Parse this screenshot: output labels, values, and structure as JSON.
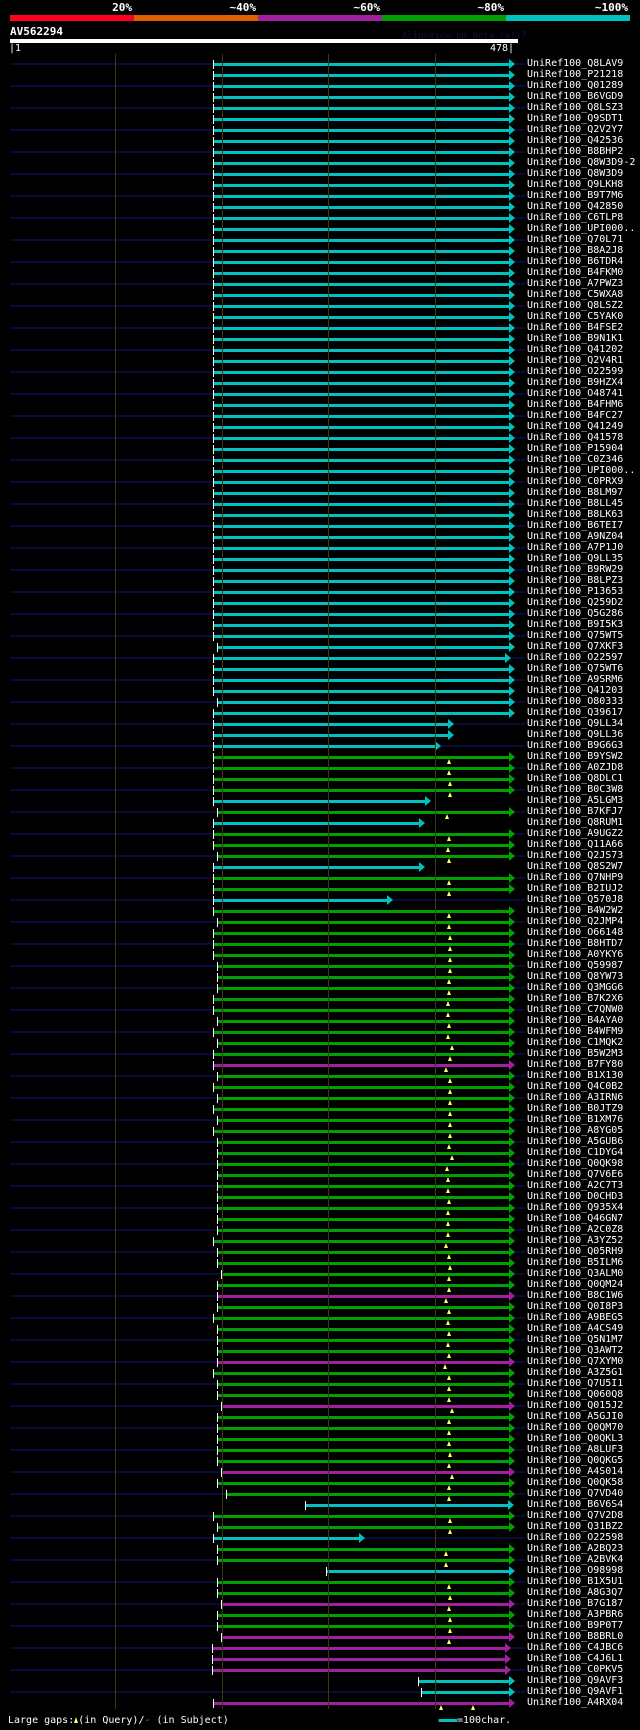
{
  "legend": {
    "labels": [
      "20%",
      "~40%",
      "~60%",
      "~80%",
      "~100%"
    ],
    "colors": [
      "#ff0020",
      "#e06000",
      "#a020a0",
      "#00a000",
      "#00c0c0"
    ]
  },
  "query": {
    "name": "AV562294",
    "credit": "AlignView.pm Beta rel.7",
    "start_label": "|1",
    "end_label": "478|",
    "length": 478
  },
  "grid_every": 100,
  "color_map": {
    "cyan": "#00c0c0",
    "green": "#00a000",
    "magenta": "#a020a0"
  },
  "hits": [
    {
      "label": "UniRef100_Q8LAV9",
      "c": "cyan",
      "s": 192,
      "e": 470
    },
    {
      "label": "UniRef100_P21218",
      "c": "cyan",
      "s": 192,
      "e": 470
    },
    {
      "label": "UniRef100_Q01289",
      "c": "cyan",
      "s": 192,
      "e": 470
    },
    {
      "label": "UniRef100_B6VGD9",
      "c": "cyan",
      "s": 192,
      "e": 470
    },
    {
      "label": "UniRef100_Q8LSZ3",
      "c": "cyan",
      "s": 192,
      "e": 470
    },
    {
      "label": "UniRef100_Q9SDT1",
      "c": "cyan",
      "s": 192,
      "e": 470
    },
    {
      "label": "UniRef100_Q2V2Y7",
      "c": "cyan",
      "s": 192,
      "e": 470
    },
    {
      "label": "UniRef100_Q42536",
      "c": "cyan",
      "s": 192,
      "e": 470
    },
    {
      "label": "UniRef100_B8BHP2",
      "c": "cyan",
      "s": 192,
      "e": 470
    },
    {
      "label": "UniRef100_Q8W3D9-2",
      "c": "cyan",
      "s": 192,
      "e": 470
    },
    {
      "label": "UniRef100_Q8W3D9",
      "c": "cyan",
      "s": 192,
      "e": 470
    },
    {
      "label": "UniRef100_Q9LKH8",
      "c": "cyan",
      "s": 192,
      "e": 470
    },
    {
      "label": "UniRef100_B9T7M6",
      "c": "cyan",
      "s": 192,
      "e": 470
    },
    {
      "label": "UniRef100_Q42850",
      "c": "cyan",
      "s": 192,
      "e": 470
    },
    {
      "label": "UniRef100_C6TLP8",
      "c": "cyan",
      "s": 192,
      "e": 470
    },
    {
      "label": "UniRef100_UPI000..",
      "c": "cyan",
      "s": 192,
      "e": 470
    },
    {
      "label": "UniRef100_Q70L71",
      "c": "cyan",
      "s": 192,
      "e": 470
    },
    {
      "label": "UniRef100_B8A2J8",
      "c": "cyan",
      "s": 192,
      "e": 470
    },
    {
      "label": "UniRef100_B6TDR4",
      "c": "cyan",
      "s": 192,
      "e": 470
    },
    {
      "label": "UniRef100_B4FKM0",
      "c": "cyan",
      "s": 192,
      "e": 470
    },
    {
      "label": "UniRef100_A7PWZ3",
      "c": "cyan",
      "s": 192,
      "e": 470
    },
    {
      "label": "UniRef100_C5WXA8",
      "c": "cyan",
      "s": 192,
      "e": 470
    },
    {
      "label": "UniRef100_Q8LSZ2",
      "c": "cyan",
      "s": 192,
      "e": 470
    },
    {
      "label": "UniRef100_C5YAK0",
      "c": "cyan",
      "s": 192,
      "e": 470
    },
    {
      "label": "UniRef100_B4FSE2",
      "c": "cyan",
      "s": 192,
      "e": 470
    },
    {
      "label": "UniRef100_B9N1K1",
      "c": "cyan",
      "s": 192,
      "e": 470
    },
    {
      "label": "UniRef100_Q41202",
      "c": "cyan",
      "s": 192,
      "e": 470
    },
    {
      "label": "UniRef100_Q2V4R1",
      "c": "cyan",
      "s": 192,
      "e": 470
    },
    {
      "label": "UniRef100_O22599",
      "c": "cyan",
      "s": 192,
      "e": 470
    },
    {
      "label": "UniRef100_B9HZX4",
      "c": "cyan",
      "s": 192,
      "e": 470
    },
    {
      "label": "UniRef100_O48741",
      "c": "cyan",
      "s": 192,
      "e": 470
    },
    {
      "label": "UniRef100_B4FHM6",
      "c": "cyan",
      "s": 192,
      "e": 470
    },
    {
      "label": "UniRef100_B4FC27",
      "c": "cyan",
      "s": 192,
      "e": 470
    },
    {
      "label": "UniRef100_Q41249",
      "c": "cyan",
      "s": 192,
      "e": 470
    },
    {
      "label": "UniRef100_Q41578",
      "c": "cyan",
      "s": 192,
      "e": 470
    },
    {
      "label": "UniRef100_P15904",
      "c": "cyan",
      "s": 192,
      "e": 470
    },
    {
      "label": "UniRef100_C0Z346",
      "c": "cyan",
      "s": 192,
      "e": 470
    },
    {
      "label": "UniRef100_UPI000..",
      "c": "cyan",
      "s": 192,
      "e": 470
    },
    {
      "label": "UniRef100_C0PRX9",
      "c": "cyan",
      "s": 192,
      "e": 470
    },
    {
      "label": "UniRef100_B8LM97",
      "c": "cyan",
      "s": 192,
      "e": 470
    },
    {
      "label": "UniRef100_B8LL45",
      "c": "cyan",
      "s": 192,
      "e": 470
    },
    {
      "label": "UniRef100_B8LK63",
      "c": "cyan",
      "s": 192,
      "e": 470
    },
    {
      "label": "UniRef100_B6TEI7",
      "c": "cyan",
      "s": 192,
      "e": 470
    },
    {
      "label": "UniRef100_A9NZ04",
      "c": "cyan",
      "s": 192,
      "e": 470
    },
    {
      "label": "UniRef100_A7P1J0",
      "c": "cyan",
      "s": 192,
      "e": 470
    },
    {
      "label": "UniRef100_Q9LL35",
      "c": "cyan",
      "s": 192,
      "e": 470
    },
    {
      "label": "UniRef100_B9RW29",
      "c": "cyan",
      "s": 192,
      "e": 470
    },
    {
      "label": "UniRef100_B8LPZ3",
      "c": "cyan",
      "s": 192,
      "e": 470
    },
    {
      "label": "UniRef100_P13653",
      "c": "cyan",
      "s": 192,
      "e": 470
    },
    {
      "label": "UniRef100_Q259D2",
      "c": "cyan",
      "s": 192,
      "e": 470
    },
    {
      "label": "UniRef100_Q5G286",
      "c": "cyan",
      "s": 192,
      "e": 470
    },
    {
      "label": "UniRef100_B9I5K3",
      "c": "cyan",
      "s": 192,
      "e": 470
    },
    {
      "label": "UniRef100_Q75WT5",
      "c": "cyan",
      "s": 192,
      "e": 470
    },
    {
      "label": "UniRef100_Q7XKF3",
      "c": "cyan",
      "s": 195,
      "e": 470
    },
    {
      "label": "UniRef100_O22597",
      "c": "cyan",
      "s": 192,
      "e": 466
    },
    {
      "label": "UniRef100_Q75WT6",
      "c": "cyan",
      "s": 192,
      "e": 470
    },
    {
      "label": "UniRef100_A9SRM6",
      "c": "cyan",
      "s": 192,
      "e": 470
    },
    {
      "label": "UniRef100_Q41203",
      "c": "cyan",
      "s": 192,
      "e": 470
    },
    {
      "label": "UniRef100_O80333",
      "c": "cyan",
      "s": 195,
      "e": 470
    },
    {
      "label": "UniRef100_Q39617",
      "c": "cyan",
      "s": 192,
      "e": 470
    },
    {
      "label": "UniRef100_Q9LL34",
      "c": "cyan",
      "s": 192,
      "e": 412
    },
    {
      "label": "UniRef100_Q9LL36",
      "c": "cyan",
      "s": 192,
      "e": 412
    },
    {
      "label": "UniRef100_B9G6G3",
      "c": "cyan",
      "s": 192,
      "e": 400
    },
    {
      "label": "UniRef100_B9YSW2",
      "c": "green",
      "s": 192,
      "e": 470,
      "g": [
        413
      ]
    },
    {
      "label": "UniRef100_A0ZJD8",
      "c": "green",
      "s": 192,
      "e": 470,
      "g": [
        413
      ]
    },
    {
      "label": "UniRef100_Q8DLC1",
      "c": "green",
      "s": 192,
      "e": 470,
      "g": [
        414
      ]
    },
    {
      "label": "UniRef100_B0C3W8",
      "c": "green",
      "s": 192,
      "e": 470,
      "g": [
        414
      ]
    },
    {
      "label": "UniRef100_A5LGM3",
      "c": "cyan",
      "s": 192,
      "e": 391
    },
    {
      "label": "UniRef100_B7KFJ7",
      "c": "green",
      "s": 195,
      "e": 470,
      "g": [
        411
      ]
    },
    {
      "label": "UniRef100_Q8RUM1",
      "c": "cyan",
      "s": 192,
      "e": 385
    },
    {
      "label": "UniRef100_A9UGZ2",
      "c": "green",
      "s": 192,
      "e": 470,
      "g": [
        413
      ]
    },
    {
      "label": "UniRef100_Q11A66",
      "c": "green",
      "s": 192,
      "e": 470,
      "g": [
        412
      ]
    },
    {
      "label": "UniRef100_Q2JS73",
      "c": "green",
      "s": 195,
      "e": 470,
      "g": [
        413
      ]
    },
    {
      "label": "UniRef100_Q8S2W7",
      "c": "cyan",
      "s": 192,
      "e": 385
    },
    {
      "label": "UniRef100_Q7NHP9",
      "c": "green",
      "s": 192,
      "e": 470,
      "g": [
        413
      ]
    },
    {
      "label": "UniRef100_B2IUJ2",
      "c": "green",
      "s": 192,
      "e": 470,
      "g": [
        413
      ]
    },
    {
      "label": "UniRef100_Q570J8",
      "c": "cyan",
      "s": 192,
      "e": 355
    },
    {
      "label": "UniRef100_B4W2W2",
      "c": "green",
      "s": 192,
      "e": 470,
      "g": [
        413
      ]
    },
    {
      "label": "UniRef100_Q2JMP4",
      "c": "green",
      "s": 195,
      "e": 470,
      "g": [
        413
      ]
    },
    {
      "label": "UniRef100_O66148",
      "c": "green",
      "s": 192,
      "e": 470,
      "g": [
        414
      ]
    },
    {
      "label": "UniRef100_B8HTD7",
      "c": "green",
      "s": 192,
      "e": 470,
      "g": [
        414
      ]
    },
    {
      "label": "UniRef100_A0YKY6",
      "c": "green",
      "s": 192,
      "e": 470,
      "g": [
        414
      ]
    },
    {
      "label": "UniRef100_Q59987",
      "c": "green",
      "s": 195,
      "e": 470,
      "g": [
        414
      ]
    },
    {
      "label": "UniRef100_Q8YW73",
      "c": "green",
      "s": 195,
      "e": 470,
      "g": [
        413
      ]
    },
    {
      "label": "UniRef100_Q3MGG6",
      "c": "green",
      "s": 195,
      "e": 470,
      "g": [
        413
      ]
    },
    {
      "label": "UniRef100_B7K2X6",
      "c": "green",
      "s": 192,
      "e": 470,
      "g": [
        412
      ]
    },
    {
      "label": "UniRef100_C7QNW0",
      "c": "green",
      "s": 192,
      "e": 470,
      "g": [
        412
      ]
    },
    {
      "label": "UniRef100_B4AYA0",
      "c": "green",
      "s": 195,
      "e": 470,
      "g": [
        413
      ]
    },
    {
      "label": "UniRef100_B4WFM9",
      "c": "green",
      "s": 192,
      "e": 470,
      "g": [
        412
      ]
    },
    {
      "label": "UniRef100_C1MQK2",
      "c": "green",
      "s": 195,
      "e": 470,
      "g": [
        416
      ]
    },
    {
      "label": "UniRef100_B5W2M3",
      "c": "green",
      "s": 192,
      "e": 470,
      "g": [
        414
      ]
    },
    {
      "label": "UniRef100_B7FY80",
      "c": "magenta",
      "s": 192,
      "e": 470,
      "g": [
        410
      ]
    },
    {
      "label": "UniRef100_B1X130",
      "c": "green",
      "s": 195,
      "e": 470,
      "g": [
        414
      ]
    },
    {
      "label": "UniRef100_Q4C0B2",
      "c": "green",
      "s": 192,
      "e": 470,
      "g": [
        414
      ]
    },
    {
      "label": "UniRef100_A3IRN6",
      "c": "green",
      "s": 195,
      "e": 470,
      "g": [
        414
      ]
    },
    {
      "label": "UniRef100_B0JTZ9",
      "c": "green",
      "s": 192,
      "e": 470,
      "g": [
        414
      ]
    },
    {
      "label": "UniRef100_B1XM76",
      "c": "green",
      "s": 195,
      "e": 470,
      "g": [
        414
      ]
    },
    {
      "label": "UniRef100_A8YG05",
      "c": "green",
      "s": 192,
      "e": 470,
      "g": [
        414
      ]
    },
    {
      "label": "UniRef100_A5GUB6",
      "c": "green",
      "s": 195,
      "e": 470,
      "g": [
        413
      ]
    },
    {
      "label": "UniRef100_C1DYG4",
      "c": "green",
      "s": 195,
      "e": 470,
      "g": [
        416
      ]
    },
    {
      "label": "UniRef100_Q0QK98",
      "c": "green",
      "s": 195,
      "e": 470,
      "g": [
        411
      ]
    },
    {
      "label": "UniRef100_Q7V6E6",
      "c": "green",
      "s": 195,
      "e": 470,
      "g": [
        412
      ]
    },
    {
      "label": "UniRef100_A2C7T3",
      "c": "green",
      "s": 195,
      "e": 470,
      "g": [
        412
      ]
    },
    {
      "label": "UniRef100_D0CHD3",
      "c": "green",
      "s": 195,
      "e": 470,
      "g": [
        413
      ]
    },
    {
      "label": "UniRef100_Q935X4",
      "c": "green",
      "s": 195,
      "e": 470,
      "g": [
        412
      ]
    },
    {
      "label": "UniRef100_Q46GN7",
      "c": "green",
      "s": 195,
      "e": 470,
      "g": [
        412
      ]
    },
    {
      "label": "UniRef100_A2C0Z8",
      "c": "green",
      "s": 195,
      "e": 470,
      "g": [
        412
      ]
    },
    {
      "label": "UniRef100_A3YZ52",
      "c": "green",
      "s": 192,
      "e": 470,
      "g": [
        410
      ]
    },
    {
      "label": "UniRef100_Q05RH9",
      "c": "green",
      "s": 195,
      "e": 470,
      "g": [
        413
      ]
    },
    {
      "label": "UniRef100_B5ILM6",
      "c": "green",
      "s": 195,
      "e": 470,
      "g": [
        414
      ]
    },
    {
      "label": "UniRef100_Q3ALM0",
      "c": "green",
      "s": 199,
      "e": 470,
      "g": [
        413
      ]
    },
    {
      "label": "UniRef100_Q0QM24",
      "c": "green",
      "s": 195,
      "e": 470,
      "g": [
        413
      ]
    },
    {
      "label": "UniRef100_B8C1W6",
      "c": "magenta",
      "s": 195,
      "e": 470,
      "g": [
        410
      ]
    },
    {
      "label": "UniRef100_Q0I8P3",
      "c": "green",
      "s": 195,
      "e": 470,
      "g": [
        413
      ]
    },
    {
      "label": "UniRef100_A9BEG5",
      "c": "green",
      "s": 192,
      "e": 470,
      "g": [
        412
      ]
    },
    {
      "label": "UniRef100_A4CS49",
      "c": "green",
      "s": 195,
      "e": 470,
      "g": [
        413
      ]
    },
    {
      "label": "UniRef100_Q5N1M7",
      "c": "green",
      "s": 195,
      "e": 470,
      "g": [
        412
      ]
    },
    {
      "label": "UniRef100_Q3AWT2",
      "c": "green",
      "s": 195,
      "e": 470,
      "g": [
        413
      ]
    },
    {
      "label": "UniRef100_Q7XYM0",
      "c": "magenta",
      "s": 195,
      "e": 470,
      "g": [
        409
      ]
    },
    {
      "label": "UniRef100_A3Z5G1",
      "c": "green",
      "s": 192,
      "e": 470,
      "g": [
        413
      ]
    },
    {
      "label": "UniRef100_Q7U5I1",
      "c": "green",
      "s": 195,
      "e": 470,
      "g": [
        413
      ]
    },
    {
      "label": "UniRef100_Q060Q8",
      "c": "green",
      "s": 195,
      "e": 470,
      "g": [
        413
      ]
    },
    {
      "label": "UniRef100_Q015J2",
      "c": "magenta",
      "s": 199,
      "e": 470,
      "g": [
        416
      ]
    },
    {
      "label": "UniRef100_A5GJI0",
      "c": "green",
      "s": 195,
      "e": 470,
      "g": [
        413
      ]
    },
    {
      "label": "UniRef100_Q0QM70",
      "c": "green",
      "s": 195,
      "e": 470,
      "g": [
        413
      ]
    },
    {
      "label": "UniRef100_Q0QKL3",
      "c": "green",
      "s": 195,
      "e": 470,
      "g": [
        413
      ]
    },
    {
      "label": "UniRef100_A8LUF3",
      "c": "green",
      "s": 195,
      "e": 470,
      "g": [
        414
      ]
    },
    {
      "label": "UniRef100_Q0QKG5",
      "c": "green",
      "s": 195,
      "e": 470,
      "g": [
        413
      ]
    },
    {
      "label": "UniRef100_A4S014",
      "c": "magenta",
      "s": 199,
      "e": 470,
      "g": [
        416
      ]
    },
    {
      "label": "UniRef100_Q0QK58",
      "c": "green",
      "s": 195,
      "e": 470,
      "g": [
        413
      ]
    },
    {
      "label": "UniRef100_Q7VD40",
      "c": "green",
      "s": 204,
      "e": 470,
      "g": [
        413
      ]
    },
    {
      "label": "UniRef100_B6V6S4",
      "c": "cyan",
      "s": 278,
      "e": 469
    },
    {
      "label": "UniRef100_Q7V2D8",
      "c": "green",
      "s": 192,
      "e": 470,
      "g": [
        414
      ]
    },
    {
      "label": "UniRef100_Q31BZ2",
      "c": "green",
      "s": 195,
      "e": 470,
      "g": [
        414
      ]
    },
    {
      "label": "UniRef100_O22598",
      "c": "cyan",
      "s": 192,
      "e": 329
    },
    {
      "label": "UniRef100_A2BQ23",
      "c": "green",
      "s": 195,
      "e": 470,
      "g": [
        410
      ]
    },
    {
      "label": "UniRef100_A2BVK4",
      "c": "green",
      "s": 195,
      "e": 470,
      "g": [
        410
      ]
    },
    {
      "label": "UniRef100_O98998",
      "c": "cyan",
      "s": 298,
      "e": 470
    },
    {
      "label": "UniRef100_B1X5U1",
      "c": "green",
      "s": 195,
      "e": 470,
      "g": [
        413
      ]
    },
    {
      "label": "UniRef100_A8G3Q7",
      "c": "green",
      "s": 195,
      "e": 470,
      "g": [
        414
      ]
    },
    {
      "label": "UniRef100_B7G187",
      "c": "magenta",
      "s": 199,
      "e": 470,
      "g": [
        413
      ]
    },
    {
      "label": "UniRef100_A3PBR6",
      "c": "green",
      "s": 195,
      "e": 470,
      "g": [
        414
      ]
    },
    {
      "label": "UniRef100_B9P0T7",
      "c": "green",
      "s": 195,
      "e": 470,
      "g": [
        414
      ]
    },
    {
      "label": "UniRef100_B8BRL0",
      "c": "magenta",
      "s": 199,
      "e": 470,
      "g": [
        413
      ]
    },
    {
      "label": "UniRef100_C4JBC6",
      "c": "magenta",
      "s": 191,
      "e": 466
    },
    {
      "label": "UniRef100_C4J6L1",
      "c": "magenta",
      "s": 191,
      "e": 466
    },
    {
      "label": "UniRef100_C0PKV5",
      "c": "magenta",
      "s": 191,
      "e": 466
    },
    {
      "label": "UniRef100_Q9AVF3",
      "c": "cyan",
      "s": 384,
      "e": 470
    },
    {
      "label": "UniRef100_Q9AVF1",
      "c": "cyan",
      "s": 387,
      "e": 470
    },
    {
      "label": "UniRef100_A4RX04",
      "c": "magenta",
      "s": 192,
      "e": 470,
      "g": [
        406,
        436
      ]
    }
  ],
  "footer": {
    "prefix": "Large gaps:",
    "query_text": "(in Query)/",
    "subject_dash": "-",
    "subject_text": " (in Subject)",
    "scale_text": "=100char."
  }
}
